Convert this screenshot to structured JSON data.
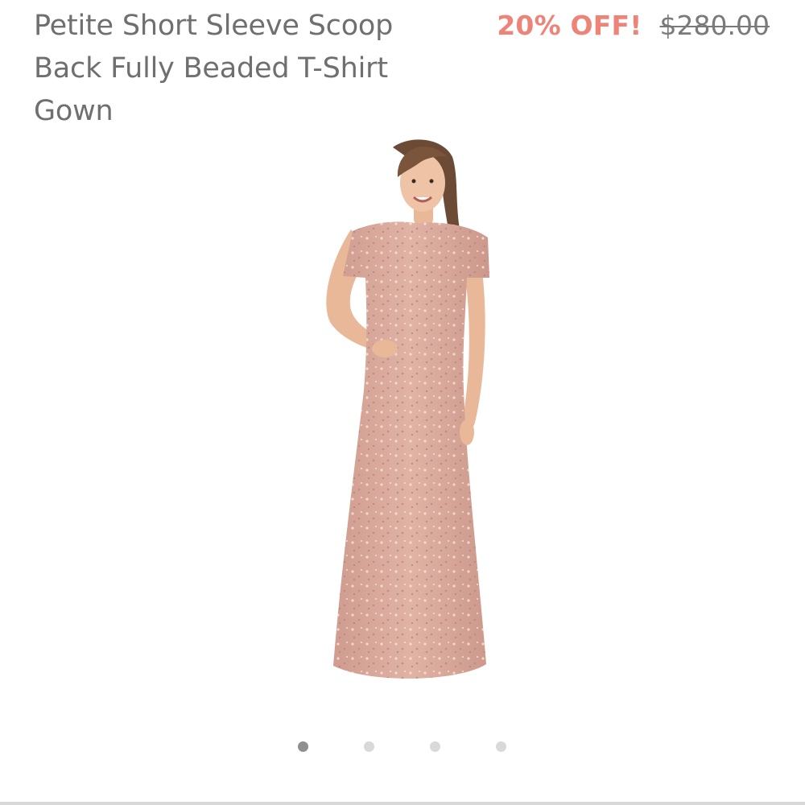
{
  "product": {
    "title": "Petite Short Sleeve Scoop Back Fully Beaded T-Shirt Gown",
    "discount_label": "20% OFF!",
    "original_price": "$280.00"
  },
  "image": {
    "alt": "Woman wearing a blush pink fully beaded short sleeve floor-length gown"
  },
  "carousel": {
    "total_slides": 4,
    "active_index": 0
  },
  "colors": {
    "title_text": "#6f6f6f",
    "discount": "#ee8478",
    "original_price": "#7a7a7a",
    "dress": "#d9a99a",
    "dot_active": "#8f8f8f",
    "dot_inactive": "#d9d9d9"
  }
}
